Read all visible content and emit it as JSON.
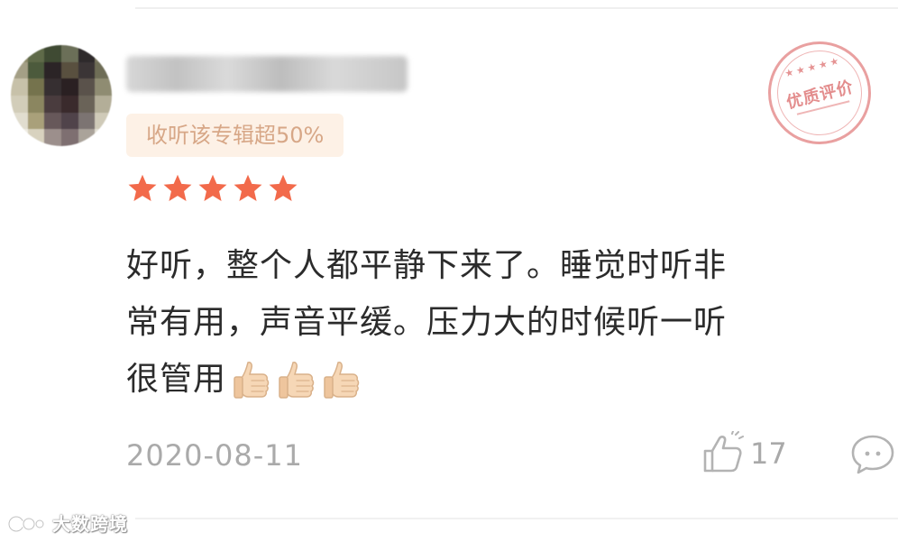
{
  "user": {
    "nickname": "█████ ████████",
    "avatar_icon": "avatar-pixelated"
  },
  "badge": {
    "label": "收听该专辑超50%"
  },
  "rating": {
    "stars": 5,
    "max": 5,
    "color": "#f26a4b"
  },
  "comment": {
    "lines": [
      "好听，整个人都平静下来了。睡觉时听非",
      "常有用，声音平缓。压力大的时候听一听",
      "很管用"
    ],
    "emoji": [
      "thumbs-up-icon",
      "thumbs-up-icon",
      "thumbs-up-icon"
    ]
  },
  "date": "2020-08-11",
  "like": {
    "icon": "thumbs-up-outline-icon",
    "count": "17"
  },
  "reply": {
    "icon": "comment-bubble-icon"
  },
  "stamp": {
    "text": "优质评价",
    "color": "#e38d8d"
  },
  "watermark": {
    "text": "大数跨境",
    "icon": "brand-logo-icon"
  },
  "colors": {
    "badge_bg": "#fdf1e6",
    "badge_text": "#d7a787",
    "body_text": "#2b2b2b",
    "muted_text": "#aaaaaa"
  }
}
